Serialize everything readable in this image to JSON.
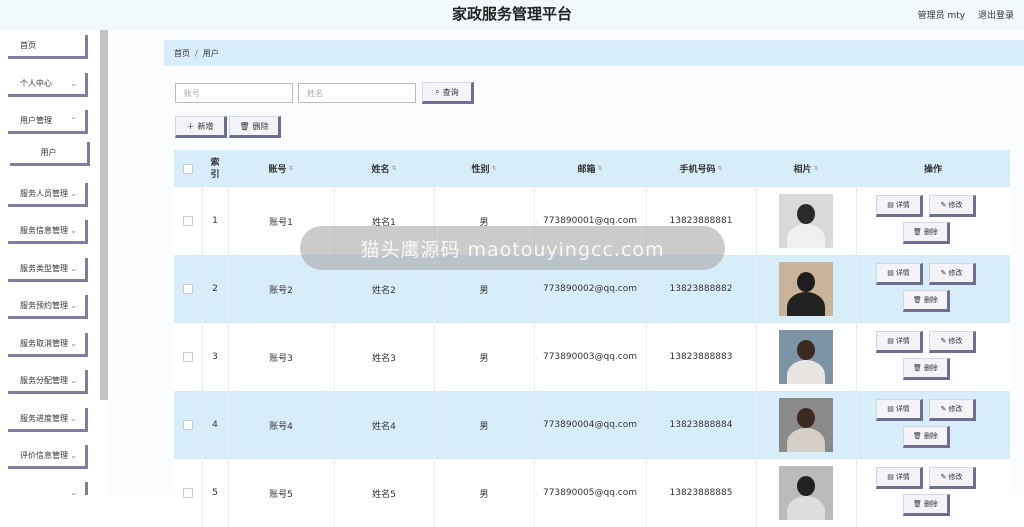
{
  "header": {
    "title": "家政服务管理平台",
    "role_user": "管理员 mty",
    "logout": "退出登录"
  },
  "sidebar": {
    "items": [
      {
        "label": "首页",
        "chevron": false
      },
      {
        "label": "个人中心",
        "chevron": true
      },
      {
        "label": "用户管理",
        "chevron": true
      },
      {
        "label": "用户",
        "chevron": false,
        "sub": true
      },
      {
        "label": "服务人员管理",
        "chevron": true
      },
      {
        "label": "服务信息管理",
        "chevron": true
      },
      {
        "label": "服务类型管理",
        "chevron": true
      },
      {
        "label": "服务预约管理",
        "chevron": true
      },
      {
        "label": "服务取消管理",
        "chevron": true
      },
      {
        "label": "服务分配管理",
        "chevron": true
      },
      {
        "label": "服务进度管理",
        "chevron": true
      },
      {
        "label": "评价信息管理",
        "chevron": true
      },
      {
        "label": "",
        "chevron": true
      }
    ]
  },
  "breadcrumb": {
    "home": "首页",
    "separator": "/",
    "current": "用户"
  },
  "search": {
    "account_placeholder": "账号",
    "name_placeholder": "姓名",
    "query_label": "查询"
  },
  "toolbar": {
    "add_label": "新增",
    "delete_label": "删除"
  },
  "table": {
    "headers": {
      "index": "索引",
      "account": "账号",
      "name": "姓名",
      "gender": "性别",
      "email": "邮箱",
      "phone": "手机号码",
      "photo": "相片",
      "ops": "操作"
    },
    "rows": [
      {
        "index": "1",
        "account": "账号1",
        "name": "姓名1",
        "gender": "男",
        "email": "773890001@qq.com",
        "phone": "13823888881"
      },
      {
        "index": "2",
        "account": "账号2",
        "name": "姓名2",
        "gender": "男",
        "email": "773890002@qq.com",
        "phone": "13823888882"
      },
      {
        "index": "3",
        "account": "账号3",
        "name": "姓名3",
        "gender": "男",
        "email": "773890003@qq.com",
        "phone": "13823888883"
      },
      {
        "index": "4",
        "account": "账号4",
        "name": "姓名4",
        "gender": "男",
        "email": "773890004@qq.com",
        "phone": "13823888884"
      },
      {
        "index": "5",
        "account": "账号5",
        "name": "姓名5",
        "gender": "男",
        "email": "773890005@qq.com",
        "phone": "13823888885"
      }
    ],
    "ops": {
      "detail": "详情",
      "edit": "修改",
      "delete": "删除"
    }
  },
  "watermark": {
    "text": "猫头鹰源码 maotouyingcc.com"
  },
  "colors": {
    "header_bg": "#f2f9fd",
    "accent_light_blue": "#d8edfa",
    "button_border": "#6e6e8e"
  }
}
